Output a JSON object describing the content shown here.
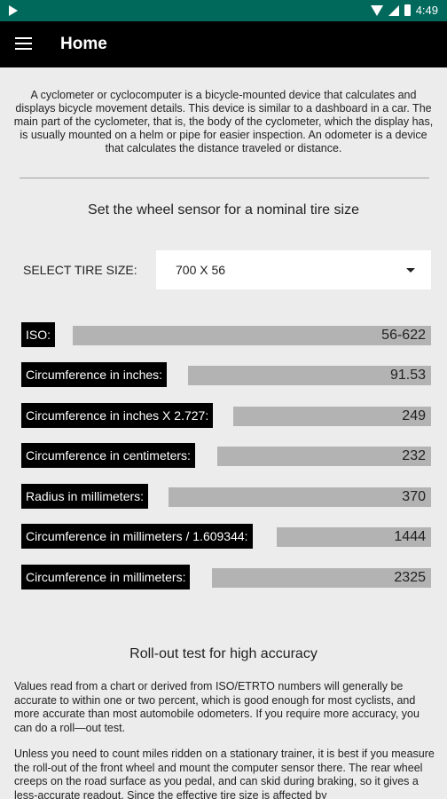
{
  "status_bar": {
    "time": "4:49",
    "icons": [
      "play-icon",
      "wifi-icon",
      "cell-signal-icon",
      "battery-icon"
    ]
  },
  "app_bar": {
    "title": "Home",
    "menu_icon": "hamburger-menu-icon"
  },
  "intro": "A cyclometer or cyclocomputer is a bicycle-mounted device that calculates and displays bicycle movement details. This device is similar to a dashboard in a car. The main part of the cyclometer, that is, the body of the cyclometer, which the display has, is usually mounted on a helm or pipe for easier inspection. An odometer is a device that calculates the distance traveled or distance.",
  "sensor": {
    "heading": "Set the wheel sensor for a nominal tire size",
    "tire_label": "SELECT TIRE SIZE:",
    "tire_value": "700 X 56"
  },
  "results": [
    {
      "label": "ISO:",
      "value": "56-622"
    },
    {
      "label": "Circumference in inches:",
      "value": "91.53"
    },
    {
      "label": "Circumference in inches X 2.727:",
      "value": "249"
    },
    {
      "label": "Circumference in centimeters:",
      "value": "232"
    },
    {
      "label": "Radius in millimeters:",
      "value": "370"
    },
    {
      "label": "Circumference in millimeters / 1.609344:",
      "value": "1444"
    },
    {
      "label": "Circumference in millimeters:",
      "value": "2325"
    }
  ],
  "rollout": {
    "heading": "Roll-out test for high accuracy",
    "para1": "Values read from a chart or derived from ISO/ETRTO numbers will generally be accurate to within one or two percent, which is good enough for most cyclists, and more accurate than most automobile odometers. If you require more accuracy, you can do a roll—out test.",
    "para2": "Unless you need to count miles ridden on a stationary trainer, it is best if you measure the roll-out of the front wheel and mount the computer sensor there. The rear wheel creeps on the road surface as you pedal, and can skid during braking, so it gives a less-accurate readout. Since the effective tire size is affected by"
  },
  "colors": {
    "status_bar": "#00695c",
    "app_bar": "#000000",
    "background": "#ececec",
    "value_bar": "#b3b3b3"
  }
}
